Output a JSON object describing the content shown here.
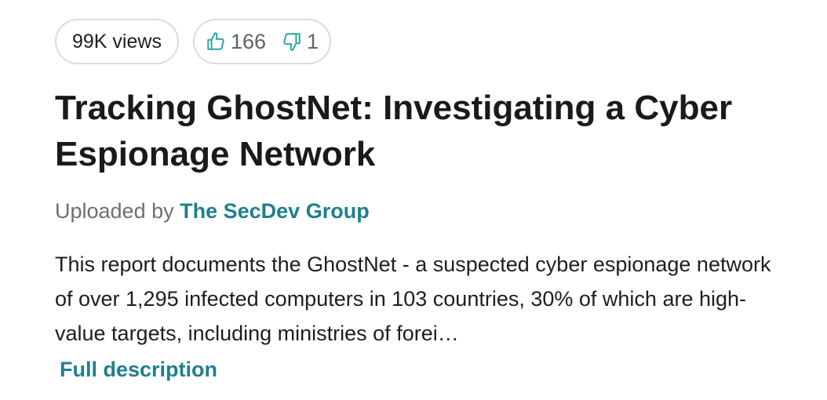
{
  "stats": {
    "views": "99K views",
    "upvotes": "166",
    "downvotes": "1"
  },
  "document": {
    "title": "Tracking GhostNet: Investigating a Cyber Espionage Network",
    "uploaded_prefix": "Uploaded by ",
    "author": "The SecDev Group",
    "description": "This report documents the GhostNet - a suspected cyber espionage network of over 1,295 infected computers in 103 countries, 30% of which are high-value targets, including ministries of forei…",
    "full_description_link": "Full description"
  },
  "colors": {
    "accent": "#1f7f8c",
    "upvote_icon": "#26a69a",
    "text": "#1e1e1e",
    "muted": "#6b6f73",
    "pill_border": "#d9dcdf"
  },
  "icons": {
    "upvote": "thumbs-up-icon",
    "downvote": "thumbs-down-icon"
  }
}
